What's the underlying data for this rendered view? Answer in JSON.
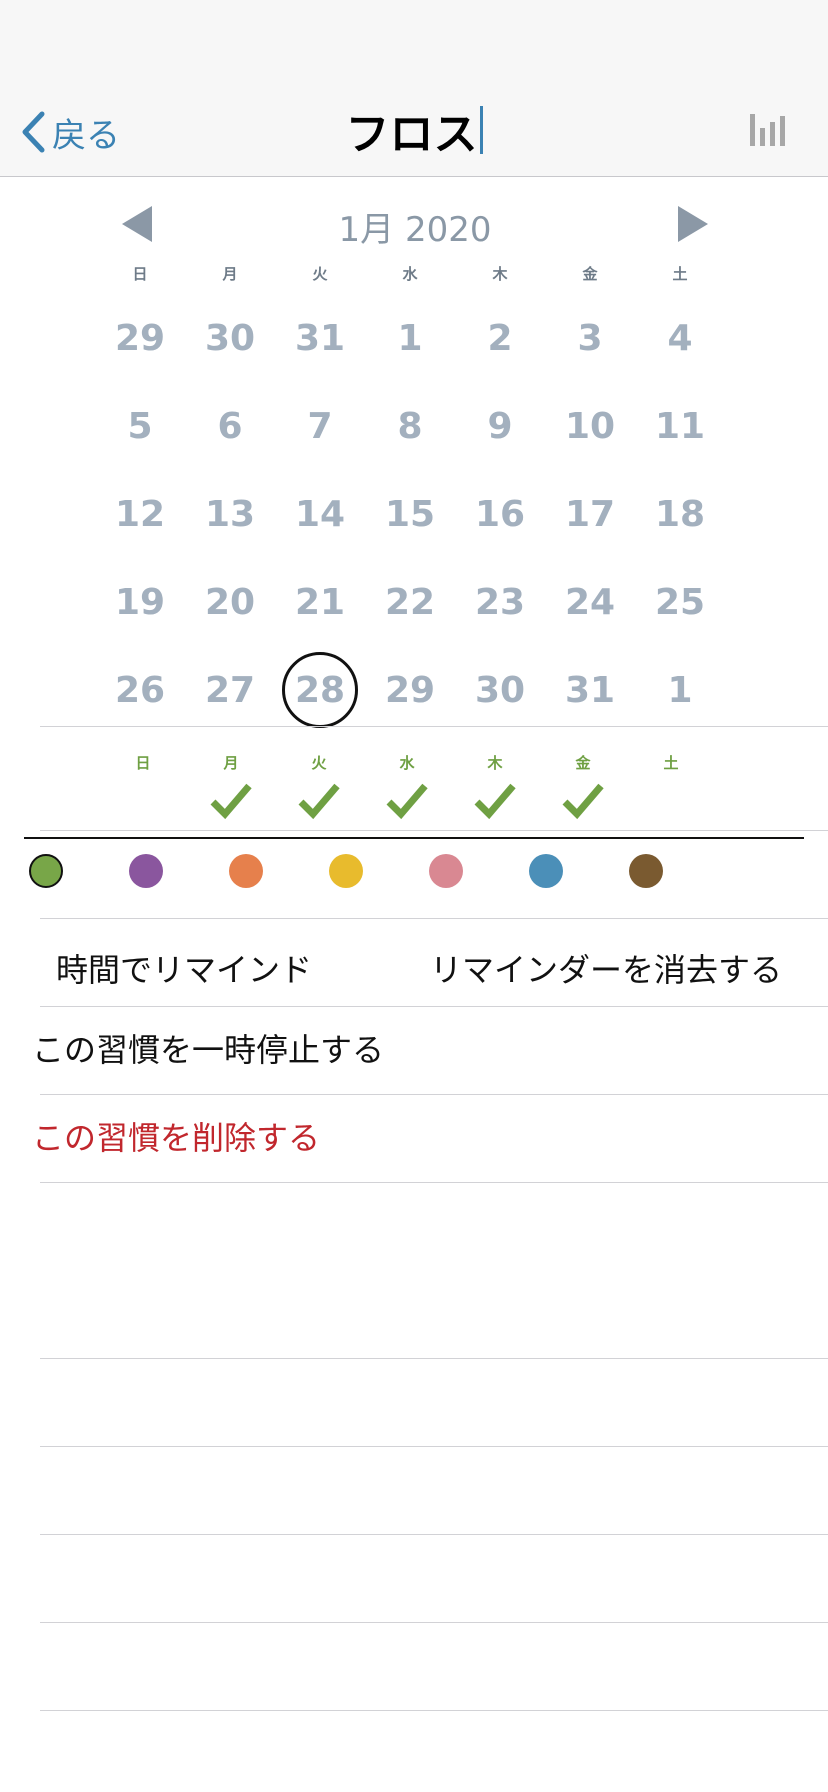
{
  "nav": {
    "back_label": "戻る",
    "title": "フロス"
  },
  "calendar": {
    "month_label": "1月 2020",
    "weekdays": [
      "日",
      "月",
      "火",
      "水",
      "木",
      "金",
      "土"
    ],
    "weeks": [
      [
        "29",
        "30",
        "31",
        "1",
        "2",
        "3",
        "4"
      ],
      [
        "5",
        "6",
        "7",
        "8",
        "9",
        "10",
        "11"
      ],
      [
        "12",
        "13",
        "14",
        "15",
        "16",
        "17",
        "18"
      ],
      [
        "19",
        "20",
        "21",
        "22",
        "23",
        "24",
        "25"
      ],
      [
        "26",
        "27",
        "28",
        "29",
        "30",
        "31",
        "1"
      ]
    ],
    "selected_day": "28"
  },
  "week_checks": {
    "labels": [
      "日",
      "月",
      "火",
      "水",
      "木",
      "金",
      "土"
    ],
    "checked": [
      false,
      true,
      true,
      true,
      true,
      true,
      false
    ],
    "check_color": "#6fa043"
  },
  "colors": {
    "options": [
      "#78a648",
      "#8a569e",
      "#e6804c",
      "#e8bb2d",
      "#d98892",
      "#4b8fb8",
      "#7a5a30"
    ],
    "selected_index": 0
  },
  "reminder": {
    "time_label": "時間でリマインド",
    "clear_label": "リマインダーを消去する"
  },
  "actions": {
    "pause_label": "この習慣を一時停止する",
    "delete_label": "この習慣を削除する"
  }
}
